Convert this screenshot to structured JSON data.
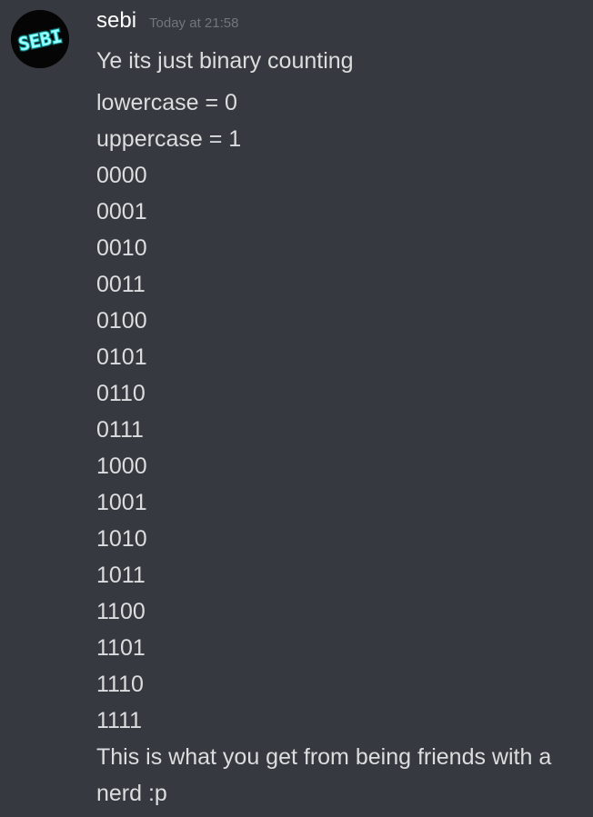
{
  "message": {
    "author": "sebi",
    "timestamp": "Today at 21:58",
    "avatar_text": "SEBI",
    "avatar_color": "#3ef0f0",
    "first_line": "Ye its just binary counting",
    "lines": [
      "lowercase = 0",
      "uppercase = 1",
      "0000",
      "0001",
      "0010",
      "0011",
      "0100",
      "0101",
      "0110",
      "0111",
      "1000",
      "1001",
      "1010",
      "1011",
      "1100",
      "1101",
      "1110",
      "1111"
    ],
    "closing": "This is what you get from being friends with a nerd :p"
  },
  "colors": {
    "background": "#36393f",
    "username": "#ffffff",
    "timestamp": "#72767d",
    "text": "#dcddde"
  }
}
